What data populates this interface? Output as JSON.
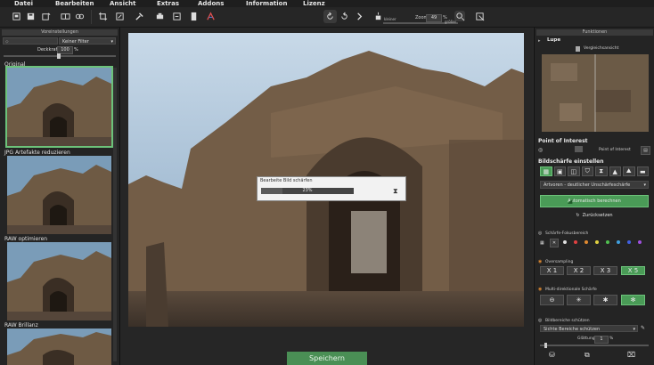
{
  "menu": [
    "Datei",
    "Bearbeiten",
    "Ansicht",
    "Extras",
    "Addons",
    "Information",
    "Lizenz"
  ],
  "toolbar": {
    "zoom_label": "Zoom",
    "zoom_value": "49",
    "zoom_unit": "%",
    "small_left": "kleiner",
    "small_right": "größer"
  },
  "left_panel": {
    "header": "Voreinstellungen",
    "filter_select": "Keiner Filter",
    "opacity_label": "Deckkraft",
    "opacity_value": "100",
    "opacity_unit": "%",
    "thumbs": [
      {
        "label": "Original",
        "selected": true
      },
      {
        "label": "JPG Artefakte reduzieren",
        "selected": false
      },
      {
        "label": "RAW optimieren",
        "selected": false
      },
      {
        "label": "RAW Brillanz",
        "selected": false
      }
    ]
  },
  "dialog": {
    "title": "Bearbeite Bild schärfen",
    "percent": "23%",
    "progress": 0.23
  },
  "save_label": "Speichern",
  "right_panel": {
    "header": "Funktionen",
    "lupe_title": "Lupe",
    "lupe_compare": "Vergleichsansicht",
    "poi_title": "Point of Interest",
    "poi_label": "Point of Interest",
    "sharp_title": "Bildschärfe einstellen",
    "sharp_select": "Artvoren - deutlicher Unschärfeschärfe",
    "auto_button": "Automatisch berechnen",
    "reset_button": "Zurücksetzen",
    "focus_label": "Schärfe-Fokusbereich",
    "oversampling_label": "Oversampling",
    "oversampling": [
      "X 1",
      "X 2",
      "X 3",
      "X 5"
    ],
    "multi_label": "Multi-direktionale Schärfe",
    "protect_label": "Bildbereiche schützen",
    "protect_select": "Sichte Bereiche schützen",
    "smooth_label": "Glättung",
    "smooth_value": "1",
    "smooth_unit": "%"
  },
  "colors": {
    "accent_green": "#4a9b57",
    "focus_dots": [
      "#e0e0e0",
      "#e04040",
      "#e08a30",
      "#e0d040",
      "#50c050",
      "#40a0e0",
      "#4060e0",
      "#a050e0"
    ]
  }
}
